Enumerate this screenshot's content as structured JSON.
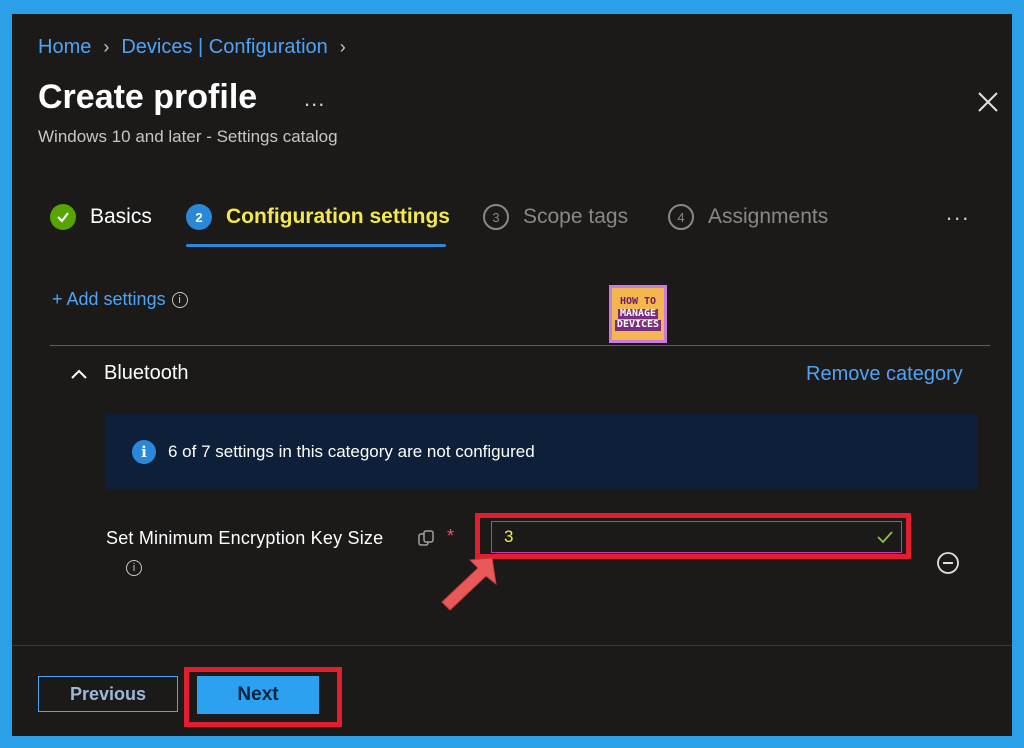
{
  "breadcrumb": {
    "home": "Home",
    "devices": "Devices | Configuration"
  },
  "header": {
    "title": "Create profile",
    "more": "...",
    "subtitle": "Windows 10 and later - Settings catalog"
  },
  "steps": [
    {
      "number": "",
      "label": "Basics",
      "state": "complete"
    },
    {
      "number": "2",
      "label": "Configuration settings",
      "state": "current"
    },
    {
      "number": "3",
      "label": "Scope tags",
      "state": "pending"
    },
    {
      "number": "4",
      "label": "Assignments",
      "state": "pending"
    }
  ],
  "steps_more": "...",
  "add_settings": "+ Add settings",
  "logo": {
    "line1": "HOW TO",
    "line2": "MANAGE",
    "line3": "DEVICES"
  },
  "category": {
    "name": "Bluetooth",
    "remove": "Remove category"
  },
  "info_bar": {
    "text": "6 of 7 settings in this category are not configured"
  },
  "setting": {
    "label": "Set Minimum Encryption Key Size",
    "required_mark": "*",
    "value": "3"
  },
  "footer": {
    "previous": "Previous",
    "next": "Next"
  },
  "colors": {
    "background": "#1b1a19",
    "link": "#4fa3f7",
    "accent": "#2b88d8",
    "current_step": "#f2e94e",
    "complete": "#57a300",
    "highlight": "#e11d2e"
  }
}
